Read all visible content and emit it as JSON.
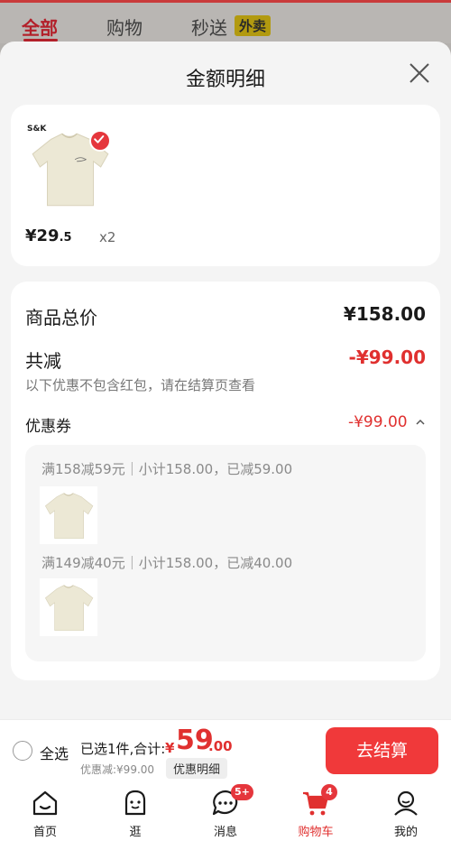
{
  "top_tabs": [
    {
      "label": "全部"
    },
    {
      "label": "购物"
    },
    {
      "label": "秒送"
    }
  ],
  "top_badge": "外卖",
  "sheet": {
    "title": "金额明细"
  },
  "product": {
    "brand_text": "S&K",
    "price_symbol": "¥",
    "price_int": "29",
    "price_dec": ".5",
    "qty": "x2"
  },
  "price_detail": {
    "total_label": "商品总价",
    "total_value": "¥158.00",
    "reduce_label": "共减",
    "reduce_value": "-¥99.00",
    "note": "以下优惠不包含红包，请在结算页查看",
    "coupon_label": "优惠券",
    "coupon_value": "-¥99.00",
    "coupon_rows": [
      {
        "text": "满158减59元｜小计158.00，已减59.00"
      },
      {
        "text": "满149减40元｜小计158.00，已减40.00"
      }
    ]
  },
  "checkout": {
    "select_all": "全选",
    "selected_text": "已选1件,合计:",
    "total_symbol": "¥",
    "total_int": "59",
    "total_dec": ".00",
    "discount_text": "优惠减:¥99.00",
    "detail_button": "优惠明细",
    "checkout_button": "去结算"
  },
  "nav": [
    {
      "label": "首页",
      "icon": "home-icon"
    },
    {
      "label": "逛",
      "icon": "browse-icon"
    },
    {
      "label": "消息",
      "icon": "message-icon",
      "badge": "5+"
    },
    {
      "label": "购物车",
      "icon": "cart-icon",
      "badge": "4"
    },
    {
      "label": "我的",
      "icon": "profile-icon"
    }
  ],
  "colors": {
    "accent": "#e0302f",
    "button": "#f0393a"
  }
}
